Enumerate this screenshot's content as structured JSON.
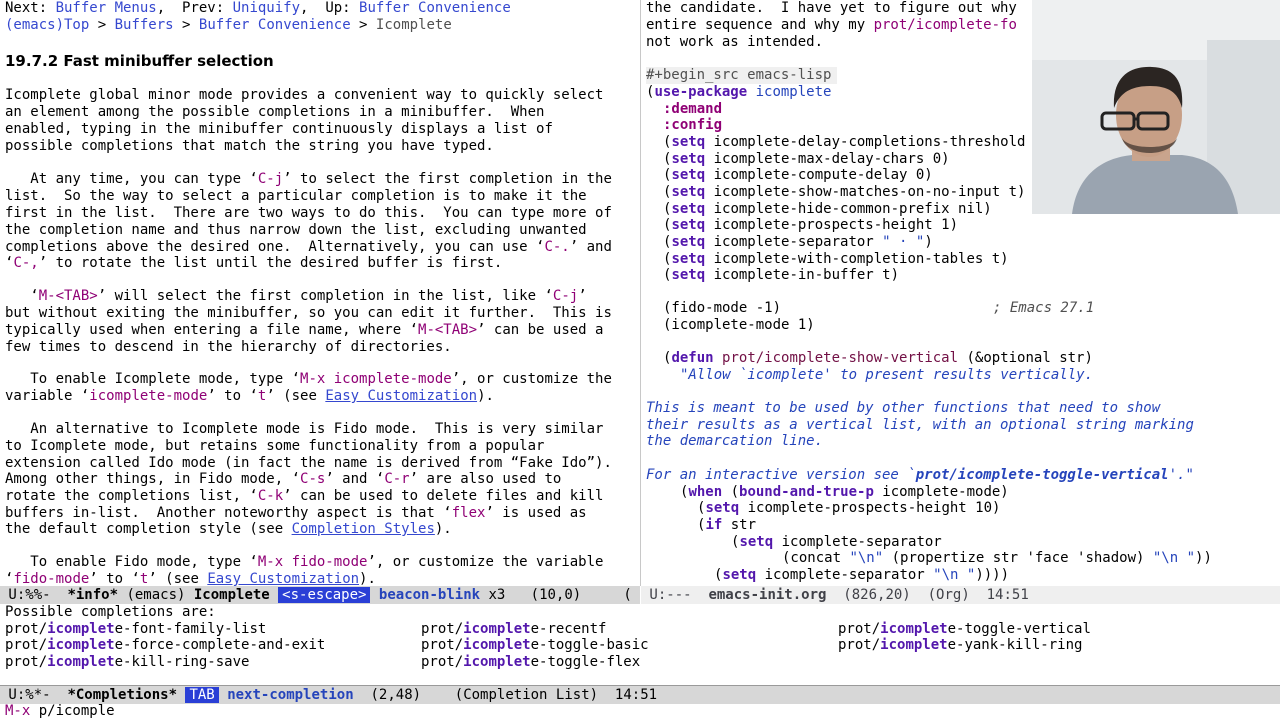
{
  "info_window": {
    "header_line_1": {
      "next_label": "Next: ",
      "next_link": "Buffer Menus",
      "prev_label": ",  Prev: ",
      "prev_link": "Uniquify",
      "up_label": ",  Up: ",
      "up_link": "Buffer Convenience"
    },
    "header_line_2": {
      "crumb1": "(emacs)Top",
      "sep1": " > ",
      "crumb2": "Buffers",
      "sep2": " > ",
      "crumb3": "Buffer Convenience",
      "sep3": " > ",
      "crumb4": "Icomplete"
    },
    "heading": "19.7.2 Fast minibuffer selection",
    "p1": [
      "Icomplete global minor mode provides a convenient way to quickly select",
      "an element among the possible completions in a minibuffer.  When",
      "enabled, typing in the minibuffer continuously displays a list of",
      "possible completions that match the string you have typed."
    ],
    "p2_l1": {
      "a": "   At any time, you can type ‘",
      "k": "C-j",
      "b": "’ to select the first completion in the"
    },
    "p2_l2": "list.  So the way to select a particular completion is to make it the",
    "p2_l3": "first in the list.  There are two ways to do this.  You can type more of",
    "p2_l4": {
      "a": "the completion name and thus narrow down the list, excluding unwanted"
    },
    "p2_l5": {
      "a": "completions above the desired one.  Alternatively, you can use ‘",
      "k": "C-.",
      "b": "’ and"
    },
    "p2_l6": {
      "a": "‘",
      "k": "C-,",
      "b": "’ to rotate the list until the desired buffer is first."
    },
    "p3_l1": {
      "a": "   ‘",
      "k": "M-<TAB>",
      "b": "’ will select the first completion in the list, like ‘",
      "k2": "C-j",
      "c": "’"
    },
    "p3_l2": "but without exiting the minibuffer, so you can edit it further.  This is",
    "p3_l3": {
      "a": "typically used when entering a file name, where ‘",
      "k": "M-<TAB>",
      "b": "’ can be used a"
    },
    "p3_l4": "few times to descend in the hierarchy of directories.",
    "p4_l1": {
      "a": "   To enable Icomplete mode, type ‘",
      "k": "M-x icomplete-mode",
      "b": "’, or customize the"
    },
    "p4_l2": {
      "a": "variable ‘",
      "k": "icomplete-mode",
      "b": "’ to ‘",
      "k2": "t",
      "c": "’ (see ",
      "link": "Easy Customization",
      "d": ")."
    },
    "p5_l1": "   An alternative to Icomplete mode is Fido mode.  This is very similar",
    "p5_l2": "to Icomplete mode, but retains some functionality from a popular",
    "p5_l3": "extension called Ido mode (in fact the name is derived from “Fake Ido”).",
    "p5_l4": {
      "a": "Among other things, in Fido mode, ‘",
      "k": "C-s",
      "b": "’ and ‘",
      "k2": "C-r",
      "c": "’ are also used to"
    },
    "p5_l5": {
      "a": "rotate the completions list, ‘",
      "k": "C-k",
      "b": "’ can be used to delete files and kill"
    },
    "p5_l6": {
      "a": "buffers in-list.  Another noteworthy aspect is that ‘",
      "k": "flex",
      "b": "’ is used as"
    },
    "p5_l7": {
      "a": "the default completion style (see ",
      "link": "Completion Styles",
      "b": ")."
    },
    "p6_l1": {
      "a": "   To enable Fido mode, type ‘",
      "k": "M-x fido-mode",
      "b": "’, or customize the variable"
    },
    "p6_l2": {
      "a": "‘",
      "k": "fido-mode",
      "b": "’ to ‘",
      "k2": "t",
      "c": "’ (see ",
      "link": "Easy Customization",
      "d": ")."
    }
  },
  "org_window": {
    "l1": {
      "a": "the candidate.  I have yet to figure out why"
    },
    "l2": {
      "a": "entire sequence and why my ",
      "v": "prot/icomplete-fo"
    },
    "l3": "not work as intended.",
    "src_begin": "#+begin_src emacs-lisp",
    "use_package": {
      "paren": "(",
      "kw": "use-package",
      "name": " icomplete"
    },
    "demand": ":demand",
    "config": ":config",
    "setqs": [
      {
        "rest": " icomplete-delay-completions-threshold"
      },
      {
        "rest": " icomplete-max-delay-chars 0)"
      },
      {
        "rest": " icomplete-compute-delay 0)"
      },
      {
        "rest": " icomplete-show-matches-on-no-input t)"
      },
      {
        "rest": " icomplete-hide-common-prefix nil)"
      },
      {
        "rest": " icomplete-prospects-height 1)"
      },
      {
        "rest": " icomplete-separator ",
        "str": "\" · \"",
        "end": ")"
      },
      {
        "rest": " icomplete-with-completion-tables t)"
      },
      {
        "rest": " icomplete-in-buffer t)"
      }
    ],
    "setq_kw": "setq",
    "fido_line": "(fido-mode -1)",
    "fido_comment": "; Emacs 27.1",
    "icomplete_line": "(icomplete-mode 1)",
    "defun": {
      "kw": "defun",
      "name": "prot/icomplete-show-vertical",
      "args": " (&optional str)"
    },
    "doc1": "\"Allow `icomplete' to present results vertically.",
    "doc2": "This is meant to be used by other functions that need to show",
    "doc3": "their results as a vertical list, with an optional string marking",
    "doc4": "the demarcation line.",
    "doc5a": "For an interactive version see `",
    "doc5b": "prot/icomplete-toggle-vertical",
    "doc5c": "'.\"",
    "when_line": {
      "kw": "when",
      "fn": "bound-and-true-p",
      "rest": " icomplete-mode)"
    },
    "setq_height": " icomplete-prospects-height 10)",
    "if_line": {
      "kw": "if",
      "rest": " str"
    },
    "setq_sep": " icomplete-separator",
    "concat_line": {
      "a": "(concat ",
      "s1": "\"\\n\"",
      "b": " (propertize str 'face 'shadow) ",
      "s2": "\"\\n \"",
      "c": "))"
    },
    "setq_sep2": {
      "rest": " icomplete-separator ",
      "str": "\"\\n \"",
      "end": "))))"
    }
  },
  "modeline_left": {
    "status": " U:%%-  ",
    "buffer": "*info*",
    "info_file": " (emacs) ",
    "node": "Icomplete",
    "key_pill": "<s-escape>",
    "cmd": "beacon-blink",
    "count": " x3",
    "pos": "   (10,0)     ("
  },
  "modeline_right": {
    "status": " U:---  ",
    "buffer": "emacs-init.org",
    "pos": "  (826,20)  (Org)  14:51"
  },
  "completions": {
    "heading": "Possible completions are:",
    "items": [
      {
        "pre": "prot/",
        "m": "icomplet",
        "post": "e-font-family-list"
      },
      {
        "pre": "prot/",
        "m": "icomplet",
        "post": "e-recentf"
      },
      {
        "pre": "prot/",
        "m": "icomplet",
        "post": "e-toggle-vertical"
      },
      {
        "pre": "prot/",
        "m": "icomplet",
        "post": "e-force-complete-and-exit"
      },
      {
        "pre": "prot/",
        "m": "icomplet",
        "post": "e-toggle-basic"
      },
      {
        "pre": "prot/",
        "m": "icomplet",
        "post": "e-yank-kill-ring"
      },
      {
        "pre": "prot/",
        "m": "icomplet",
        "post": "e-kill-ring-save"
      },
      {
        "pre": "prot/",
        "m": "icomplet",
        "post": "e-toggle-flex"
      }
    ]
  },
  "modeline_bottom": {
    "status": " U:%*-  ",
    "buffer": "*Completions*",
    "key_pill": "TAB",
    "cmd": "next-completion",
    "pos": "  (2,48)    (Completion List)  14:51"
  },
  "minibuffer": {
    "prompt": "M-x ",
    "input": "p/icomple"
  },
  "colors": {
    "link": "#3548cf",
    "keybinding": "#8f0075",
    "keyword": "#5317ac",
    "docstring": "#2544bb",
    "pill_bg": "#2a3fd6"
  }
}
